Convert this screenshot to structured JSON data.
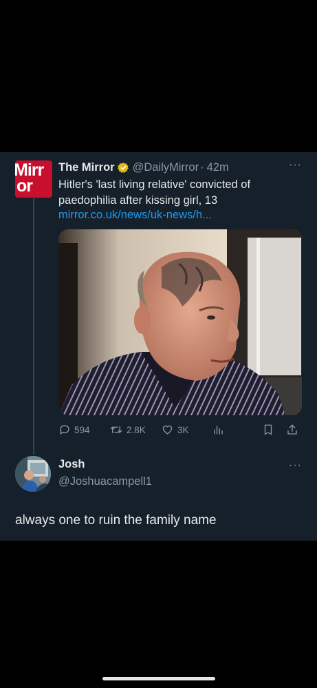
{
  "tweet": {
    "avatar_text_line1": "Mirr",
    "avatar_text_line2": "or",
    "author_name": "The Mirror",
    "author_handle": "@DailyMirror",
    "separator": "·",
    "time": "42m",
    "more": "···",
    "text": "Hitler's 'last living relative' convicted of paedophilia after kissing girl, 13",
    "link": "mirror.co.uk/news/uk-news/h...",
    "actions": {
      "replies": "594",
      "retweets": "2.8K",
      "likes": "3K"
    }
  },
  "reply": {
    "author_name": "Josh",
    "author_handle": "@Joshuacampell1",
    "more": "···",
    "text": "always one to ruin the family name"
  },
  "colors": {
    "background": "#000000",
    "card": "#15202b",
    "link": "#1d9bf0",
    "secondary_text": "#8b98a5",
    "mirror_red": "#c8102e",
    "verified_gold": "#e2b719"
  },
  "icons": [
    "verified-badge-icon",
    "reply-icon",
    "retweet-icon",
    "like-icon",
    "analytics-icon",
    "bookmark-icon",
    "share-icon",
    "more-icon"
  ]
}
